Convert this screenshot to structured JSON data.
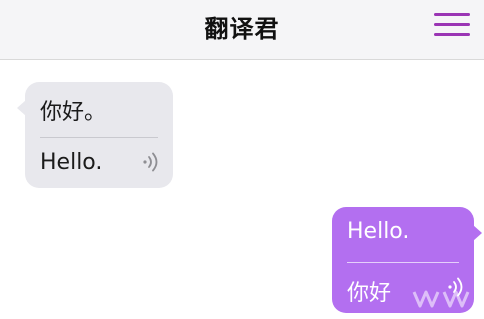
{
  "header": {
    "title": "翻译君",
    "menu_icon": "hamburger-menu-icon",
    "accent_color": "#9a35b4"
  },
  "messages": [
    {
      "direction": "incoming",
      "source_text": "你好。",
      "translation_text": "Hello.",
      "speaker_icon": "speaker-sound-icon",
      "bubble_color": "#e8e8ed"
    },
    {
      "direction": "outgoing",
      "source_text": "Hello.",
      "translation_text": "你好",
      "speaker_icon": "speaker-sound-icon",
      "bubble_color": "#b36ff0"
    }
  ]
}
